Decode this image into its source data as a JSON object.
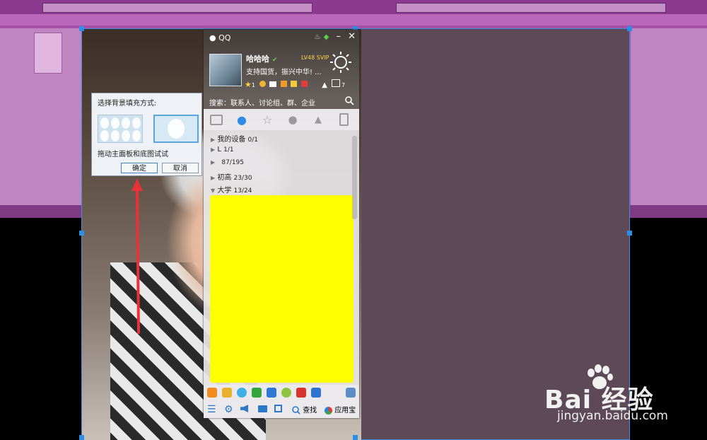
{
  "qq": {
    "app_name": "QQ",
    "nickname": "哈哈哈",
    "level": "LV48 SVIP",
    "signature": "支持国货，振兴中华! ...",
    "status_counts": {
      "stars": "1",
      "mail": "7"
    },
    "search_placeholder": "搜索：联系人、讨论组、群、企业",
    "groups": [
      {
        "name": "我的设备",
        "count": "0/1",
        "expanded": false
      },
      {
        "name": "L",
        "count": "1/1",
        "expanded": false
      },
      {
        "name": "",
        "count": "87/195",
        "expanded": false
      },
      {
        "name": "初高",
        "count": "23/30",
        "expanded": false
      },
      {
        "name": "大学",
        "count": "13/24",
        "expanded": true
      }
    ],
    "bottom": {
      "find_label": "查找",
      "app_store_label": "应用宝"
    }
  },
  "dialog": {
    "title": "选择背景填充方式:",
    "hint": "拖动主面板和底图试试",
    "ok_label": "确定",
    "cancel_label": "取消"
  },
  "watermark": {
    "brand": "Bai  经验",
    "url": "jingyan.baidu.com"
  },
  "colors": {
    "desktop": "#a64fa8",
    "canvas": "#5e4a57",
    "redaction": "#fdff00",
    "arrow": "#e8323a",
    "selection": "#2b8fe8"
  }
}
